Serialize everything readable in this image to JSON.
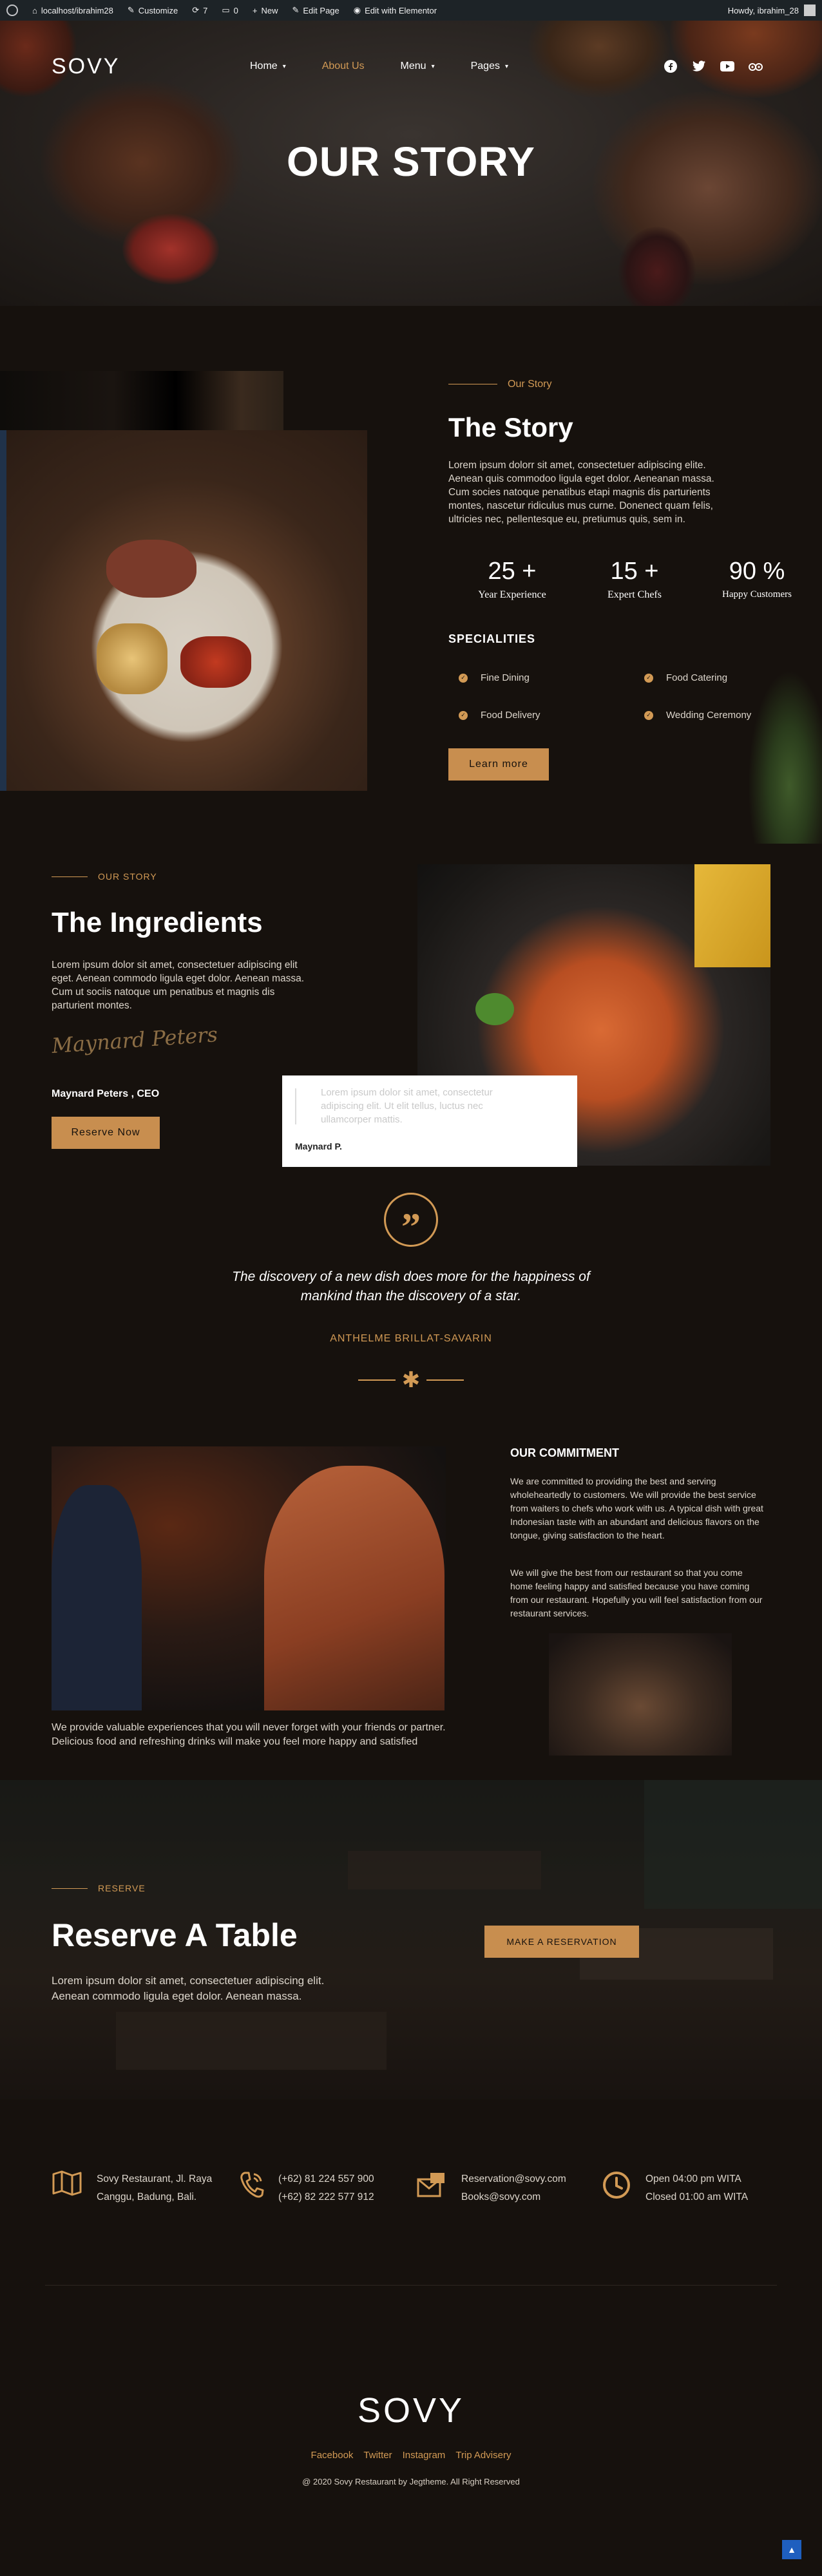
{
  "admin_bar": {
    "site": "localhost/ibrahim28",
    "customize": "Customize",
    "updates": "7",
    "comments": "0",
    "new": "New",
    "edit_page": "Edit Page",
    "elementor": "Edit with Elementor",
    "greeting": "Howdy, ibrahim_28"
  },
  "header": {
    "logo": "SOVY",
    "nav": [
      {
        "label": "Home",
        "caret": "▾"
      },
      {
        "label": "About Us"
      },
      {
        "label": "Menu",
        "caret": "▾"
      },
      {
        "label": "Pages",
        "caret": "▾"
      }
    ],
    "social_icons": [
      "facebook-icon",
      "twitter-icon",
      "youtube-icon",
      "tripadvisor-icon"
    ]
  },
  "hero": {
    "title": "OUR STORY"
  },
  "story": {
    "eyebrow": "Our Story",
    "title": "The Story",
    "body": "Lorem ipsum dolorr sit amet, consectetuer adipiscing elite. Aenean quis commodoo ligula eget dolor. Aeneanan massa. Cum socies natoque penatibus etapi magnis dis parturients montes, nascetur ridiculus mus curne. Donenect quam felis, ultricies nec, pellentesque eu, pretiumus quis, sem in.",
    "stats": [
      {
        "num": "25 +",
        "label": "Year Experience"
      },
      {
        "num": "15 +",
        "label": "Expert Chefs"
      },
      {
        "num": "90 %",
        "label": "Happy Customers"
      }
    ],
    "specialities_title": "SPECIALITIES",
    "specialities": [
      "Fine Dining",
      "Food Catering",
      "Food Delivery",
      "Wedding Ceremony"
    ],
    "button": "Learn more"
  },
  "ingredients": {
    "eyebrow": "OUR STORY",
    "title": "The Ingredients",
    "body": "Lorem ipsum dolor sit amet, consectetuer adipiscing elit eget. Aenean commodo ligula eget dolor. Aenean massa. Cum ut sociis natoque um penatibus et magnis dis parturient montes.",
    "signature": "Maynard Peters",
    "ceo": "Maynard Peters , CEO",
    "button": "Reserve Now",
    "card_text": "Lorem ipsum dolor sit amet, consectetur adipiscing elit. Ut elit tellus, luctus nec ullamcorper mattis.",
    "card_name": "Maynard P."
  },
  "quote": {
    "text": "The discovery of a new dish does more for the happiness of mankind than the discovery of a star.",
    "author": "ANTHELME BRILLAT-SAVARIN"
  },
  "commitment": {
    "title": "OUR COMMITMENT",
    "p1": "We are committed to providing the best and serving wholeheartedly to customers. We will provide the best service from waiters to chefs who work with us. A typical dish with great Indonesian taste with an abundant and delicious flavors on the tongue, giving satisfaction to the heart.",
    "p2": "We will give the best from our restaurant so that you come home feeling happy and satisfied because you have coming from our restaurant. Hopefully you will feel satisfaction from our restaurant services.",
    "caption": "We provide valuable experiences that you will never forget with your friends or partner. Delicious food and refreshing drinks will make you feel more happy and satisfied"
  },
  "reserve": {
    "eyebrow": "RESERVE",
    "title": "Reserve A Table",
    "body": "Lorem ipsum dolor sit amet, consectetuer adipiscing elit. Aenean commodo ligula eget dolor. Aenean massa.",
    "button": "MAKE A RESERVATION"
  },
  "contact": [
    {
      "icon": "map-icon",
      "line1": "Sovy Restaurant, Jl. Raya",
      "line2": "Canggu, Badung, Bali."
    },
    {
      "icon": "phone-icon",
      "line1": "(+62) 81 224 557 900",
      "line2": "(+62) 82 222 577 912"
    },
    {
      "icon": "mail-icon",
      "line1": "Reservation@sovy.com",
      "line2": "Books@sovy.com"
    },
    {
      "icon": "clock-icon",
      "line1": "Open 04:00 pm WITA",
      "line2": "Closed 01:00 am WITA"
    }
  ],
  "footer": {
    "logo": "SOVY",
    "links": [
      "Facebook",
      "Twitter",
      "Instagram",
      "Trip Advisery"
    ],
    "copyright": "@ 2020 Sovy Restaurant by Jegtheme. All Right Reserved"
  },
  "colors": {
    "accent": "#d29a55",
    "background": "#16110d"
  }
}
